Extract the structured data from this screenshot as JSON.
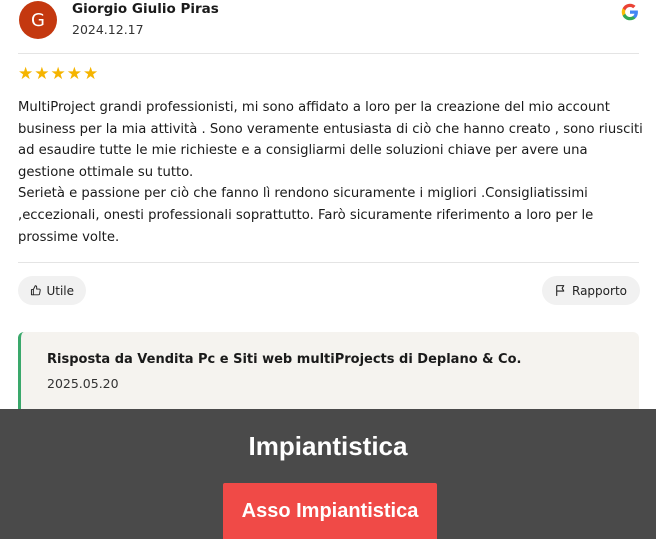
{
  "review": {
    "avatar_letter": "G",
    "author": "Giorgio Giulio Piras",
    "date": "2024.12.17",
    "source_icon": "google-icon",
    "rating": 5,
    "stars": [
      "★",
      "★",
      "★",
      "★",
      "★"
    ],
    "text": "MultiProject grandi professionisti, mi sono affidato a loro per la creazione del mio account\nbusiness per la mia attività . Sono veramente entusiasta di ciò che hanno creato , sono riusciti\nad esaudire tutte le mie richieste e a consigliarmi delle soluzioni chiave per avere una\ngestione ottimale su tutto.\nSerietà e passione per ciò che fanno lì rendono sicuramente i migliori .Consigliatissimi\n,eccezionali, onesti professionali soprattutto. Farò sicuramente riferimento a loro per le\nprossime volte.",
    "helpful_label": "Utile",
    "report_label": "Rapporto"
  },
  "reply": {
    "title": "Risposta da Vendita Pc e Siti web multiProjects di Deplano & Co.",
    "date": "2025.05.20",
    "accent_color": "#3aa86b"
  },
  "banner": {
    "title": "Impiantistica",
    "button_label": "Asso Impiantistica",
    "button_color": "#f04a47",
    "background_color": "#4a4a4a"
  }
}
